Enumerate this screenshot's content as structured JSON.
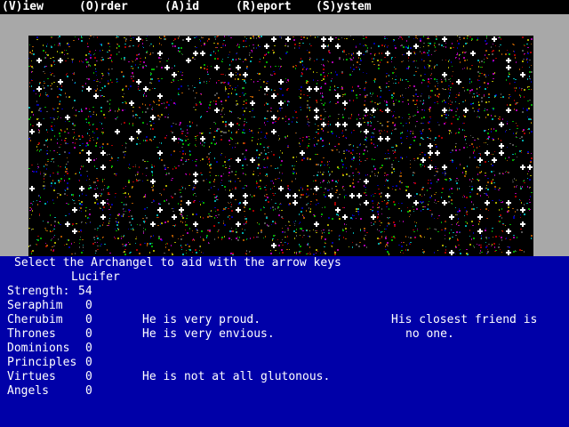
{
  "menu": [
    {
      "label": "(V)iew"
    },
    {
      "label": "(O)rder"
    },
    {
      "label": "(A)id"
    },
    {
      "label": "(R)eport"
    },
    {
      "label": "(S)ystem"
    }
  ],
  "colors": {
    "menu_bg": "#000000",
    "frame": "#a8a8a8",
    "map_bg": "#000000",
    "panel_bg": "#0000a8",
    "text": "#ffffff"
  },
  "prompt": "Select the Archangel to aid with the arrow keys",
  "archangel": {
    "name": "Lucifer",
    "strength_label": "Strength:",
    "strength_value": "54"
  },
  "choirs": [
    {
      "name": "Seraphim",
      "value": "0"
    },
    {
      "name": "Cherubim",
      "value": "0"
    },
    {
      "name": "Thrones",
      "value": "0"
    },
    {
      "name": "Dominions",
      "value": "0"
    },
    {
      "name": "Principles",
      "value": "0"
    },
    {
      "name": "Virtues",
      "value": "0"
    },
    {
      "name": "Angels",
      "value": "0"
    }
  ],
  "traits": [
    "He is very proud.",
    "He is very envious.",
    "He is not at all glutonous."
  ],
  "friend": {
    "line1": "His closest friend is",
    "line2": "no one."
  }
}
